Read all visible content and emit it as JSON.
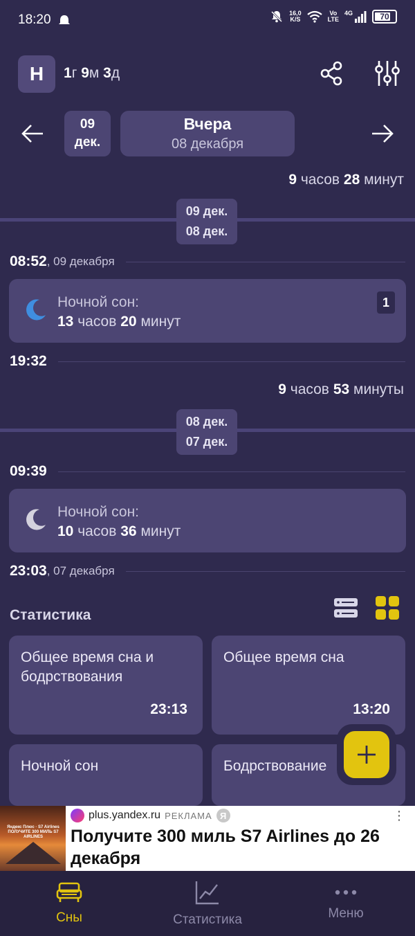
{
  "status": {
    "time": "18:20",
    "net_speed_value": "16,0",
    "net_speed_unit": "K/S",
    "volte_top": "Vo",
    "volte_bottom": "LTE",
    "network": "4G",
    "battery": "70"
  },
  "header": {
    "avatar_letter": "Н",
    "age_y": "1",
    "age_y_unit": "г",
    "age_m": "9",
    "age_m_unit": "м",
    "age_d": "3",
    "age_d_unit": "д"
  },
  "date_nav": {
    "chip_day": "09",
    "chip_month": "дек.",
    "title": "Вчера",
    "subtitle": "08 декабря"
  },
  "timeline": {
    "gap1": {
      "h": "9",
      "h_unit": "часов",
      "m": "28",
      "m_unit": "минут"
    },
    "sep1": {
      "top": "09 дек.",
      "bottom": "08 дек."
    },
    "t1": {
      "time": "08:52",
      "date": ", 09 декабря"
    },
    "card1": {
      "label": "Ночной сон:",
      "h": "13",
      "h_unit": "часов",
      "m": "20",
      "m_unit": "минут",
      "badge": "1"
    },
    "t2": {
      "time": "19:32"
    },
    "gap2": {
      "h": "9",
      "h_unit": "часов",
      "m": "53",
      "m_unit": "минуты"
    },
    "sep2": {
      "top": "08 дек.",
      "bottom": "07 дек."
    },
    "t3": {
      "time": "09:39"
    },
    "card2": {
      "label": "Ночной сон:",
      "h": "10",
      "h_unit": "часов",
      "m": "36",
      "m_unit": "минут"
    },
    "t4": {
      "time": "23:03",
      "date": ", 07 декабря"
    }
  },
  "stats": {
    "title": "Статистика",
    "cards": [
      {
        "label": "Общее время сна и бодрствования",
        "value": "23:13"
      },
      {
        "label": "Общее время сна",
        "value": "13:20"
      },
      {
        "label": "Ночной сон",
        "value": ""
      },
      {
        "label": "Бодрствование",
        "value": ""
      }
    ]
  },
  "ad": {
    "img_text": "Яндекс Плюс · S7 Airlines ПОЛУЧИТЕ 300 МИЛЬ S7 AIRLINES",
    "source": "plus.yandex.ru",
    "tag": "РЕКЛАМА",
    "ya": "Я",
    "title": "Получите 300 миль S7 Airlines до 26 декабря"
  },
  "nav": {
    "items": [
      {
        "label": "Сны",
        "active": true
      },
      {
        "label": "Статистика",
        "active": false
      },
      {
        "label": "Меню",
        "active": false
      }
    ]
  },
  "colors": {
    "background": "#2f2a4e",
    "card": "#4c4573",
    "accent_yellow": "#e2c40f",
    "moon_blue": "#3f8ee0",
    "moon_gray": "#d4d2de"
  },
  "icons": [
    "bell-off-icon",
    "wifi-icon",
    "signal-icon",
    "share-icon",
    "sliders-icon",
    "arrow-left-icon",
    "arrow-right-icon",
    "moon-icon",
    "list-view-icon",
    "grid-view-icon",
    "plus-icon",
    "bed-icon",
    "chart-line-icon",
    "more-icon"
  ]
}
